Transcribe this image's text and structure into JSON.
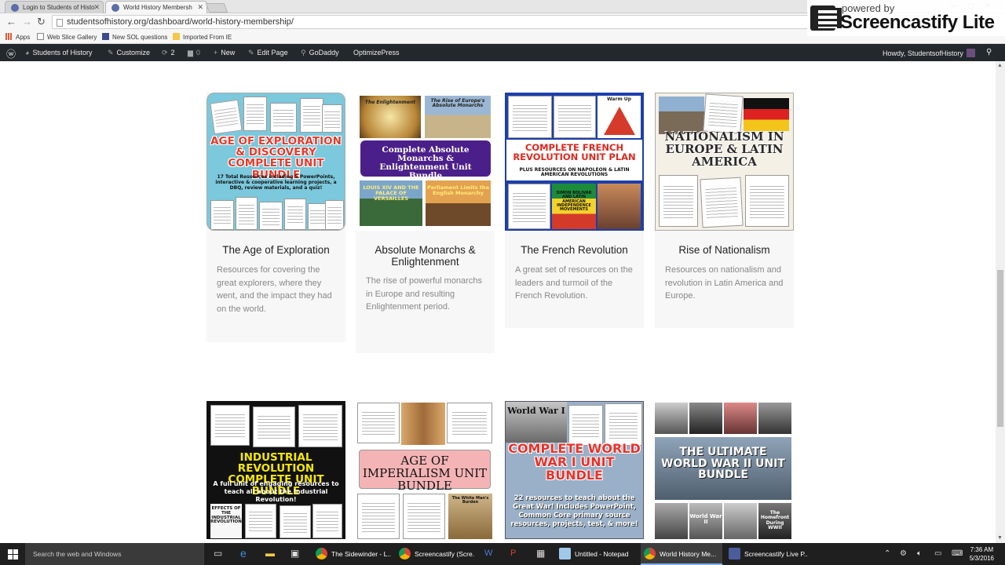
{
  "browser": {
    "tabs": [
      {
        "label": "Login to Students of Histo",
        "active": false
      },
      {
        "label": "World History Membersh",
        "active": true
      }
    ],
    "url": "studentsofhistory.org/dashboard/world-history-membership/",
    "bookmarks": [
      "Apps",
      "Web Slice Gallery",
      "New SOL questions",
      "Imported From IE"
    ]
  },
  "overlay": {
    "line1": "powered by",
    "line2": "Screencastify Lite"
  },
  "adminbar": {
    "site": "Students of History",
    "customize": "Customize",
    "updates": "2",
    "comments": "0",
    "new": "New",
    "edit": "Edit Page",
    "godaddy": "GoDaddy",
    "optimize": "OptimizePress",
    "howdy": "Howdy, StudentsofHistory"
  },
  "cards": [
    {
      "title": "The Age of Exploration",
      "desc": "Resources for covering the great explorers, where they went, and the impact they had on the world.",
      "thumb": {
        "headline": "AGE OF EXPLORATION & DISCOVERY COMPLETE UNIT BUNDLE",
        "sub": "17 Total Resources including 5 PowerPoints, interactive & cooperative learning projects, a DBQ, review materials, and a quiz!"
      }
    },
    {
      "title": "Absolute Monarchs & Enlightenment",
      "desc": "The rise of powerful monarchs in Europe and resulting Enlightenment period.",
      "thumb": {
        "headline": "Complete Absolute Monarchs & Enlightenment Unit Bundle",
        "p1": "The Enlightenment",
        "p2": "The Rise of Europe's Absolute Monarchs",
        "p3": "LOUIS XIV AND THE PALACE OF VERSAILLES",
        "p4": "Parliament Limits the English Monarchy"
      }
    },
    {
      "title": "The French Revolution",
      "desc": "A great set of resources on the leaders and turmoil of the French Revolution.",
      "thumb": {
        "headline": "COMPLETE FRENCH REVOLUTION UNIT PLAN",
        "sub": "PLUS RESOURCES ON NAPOLEON & LATIN AMERICAN REVOLUTIONS",
        "p1": "Warm Up",
        "p2": "SIMON BOLIVAR AND LATIN AMERICAN INDEPENDENCE MOVEMENTS"
      }
    },
    {
      "title": "Rise of Nationalism",
      "desc": "Resources on nationalism and revolution in Latin America and Europe.",
      "thumb": {
        "headline": "NATIONALISM IN EUROPE & LATIN AMERICA"
      }
    },
    {
      "title": "",
      "desc": "",
      "thumb": {
        "headline": "INDUSTRIAL REVOLUTION COMPLETE UNIT BUNDLE",
        "sub": "A full unit of engaging resources to teach all about the Industrial Revolution!",
        "p1": "EFFECTS OF THE INDUSTRIAL REVOLUTION"
      }
    },
    {
      "title": "",
      "desc": "",
      "thumb": {
        "headline": "AGE OF IMPERIALISM UNIT BUNDLE",
        "p1": "The White Man's Burden"
      }
    },
    {
      "title": "",
      "desc": "",
      "thumb": {
        "headline": "COMPLETE WORLD WAR I UNIT BUNDLE",
        "sub": "22 resources to teach about the Great War! Includes PowerPoint, Common Core primary source resources, projects, test, & more!",
        "p1": "World War I"
      }
    },
    {
      "title": "",
      "desc": "",
      "thumb": {
        "headline": "THE ULTIMATE WORLD WAR II UNIT BUNDLE",
        "p1": "World War II",
        "p2": "The Homefront During WWII"
      }
    }
  ],
  "taskbar": {
    "search": "Search the web and Windows",
    "apps": [
      "The Sidewinder - L...",
      "Screencastify (Scre...",
      "Untitled - Notepad",
      "World History Me...",
      "Screencastify Live P..."
    ],
    "time": "7:36 AM",
    "date": "5/3/2016"
  }
}
